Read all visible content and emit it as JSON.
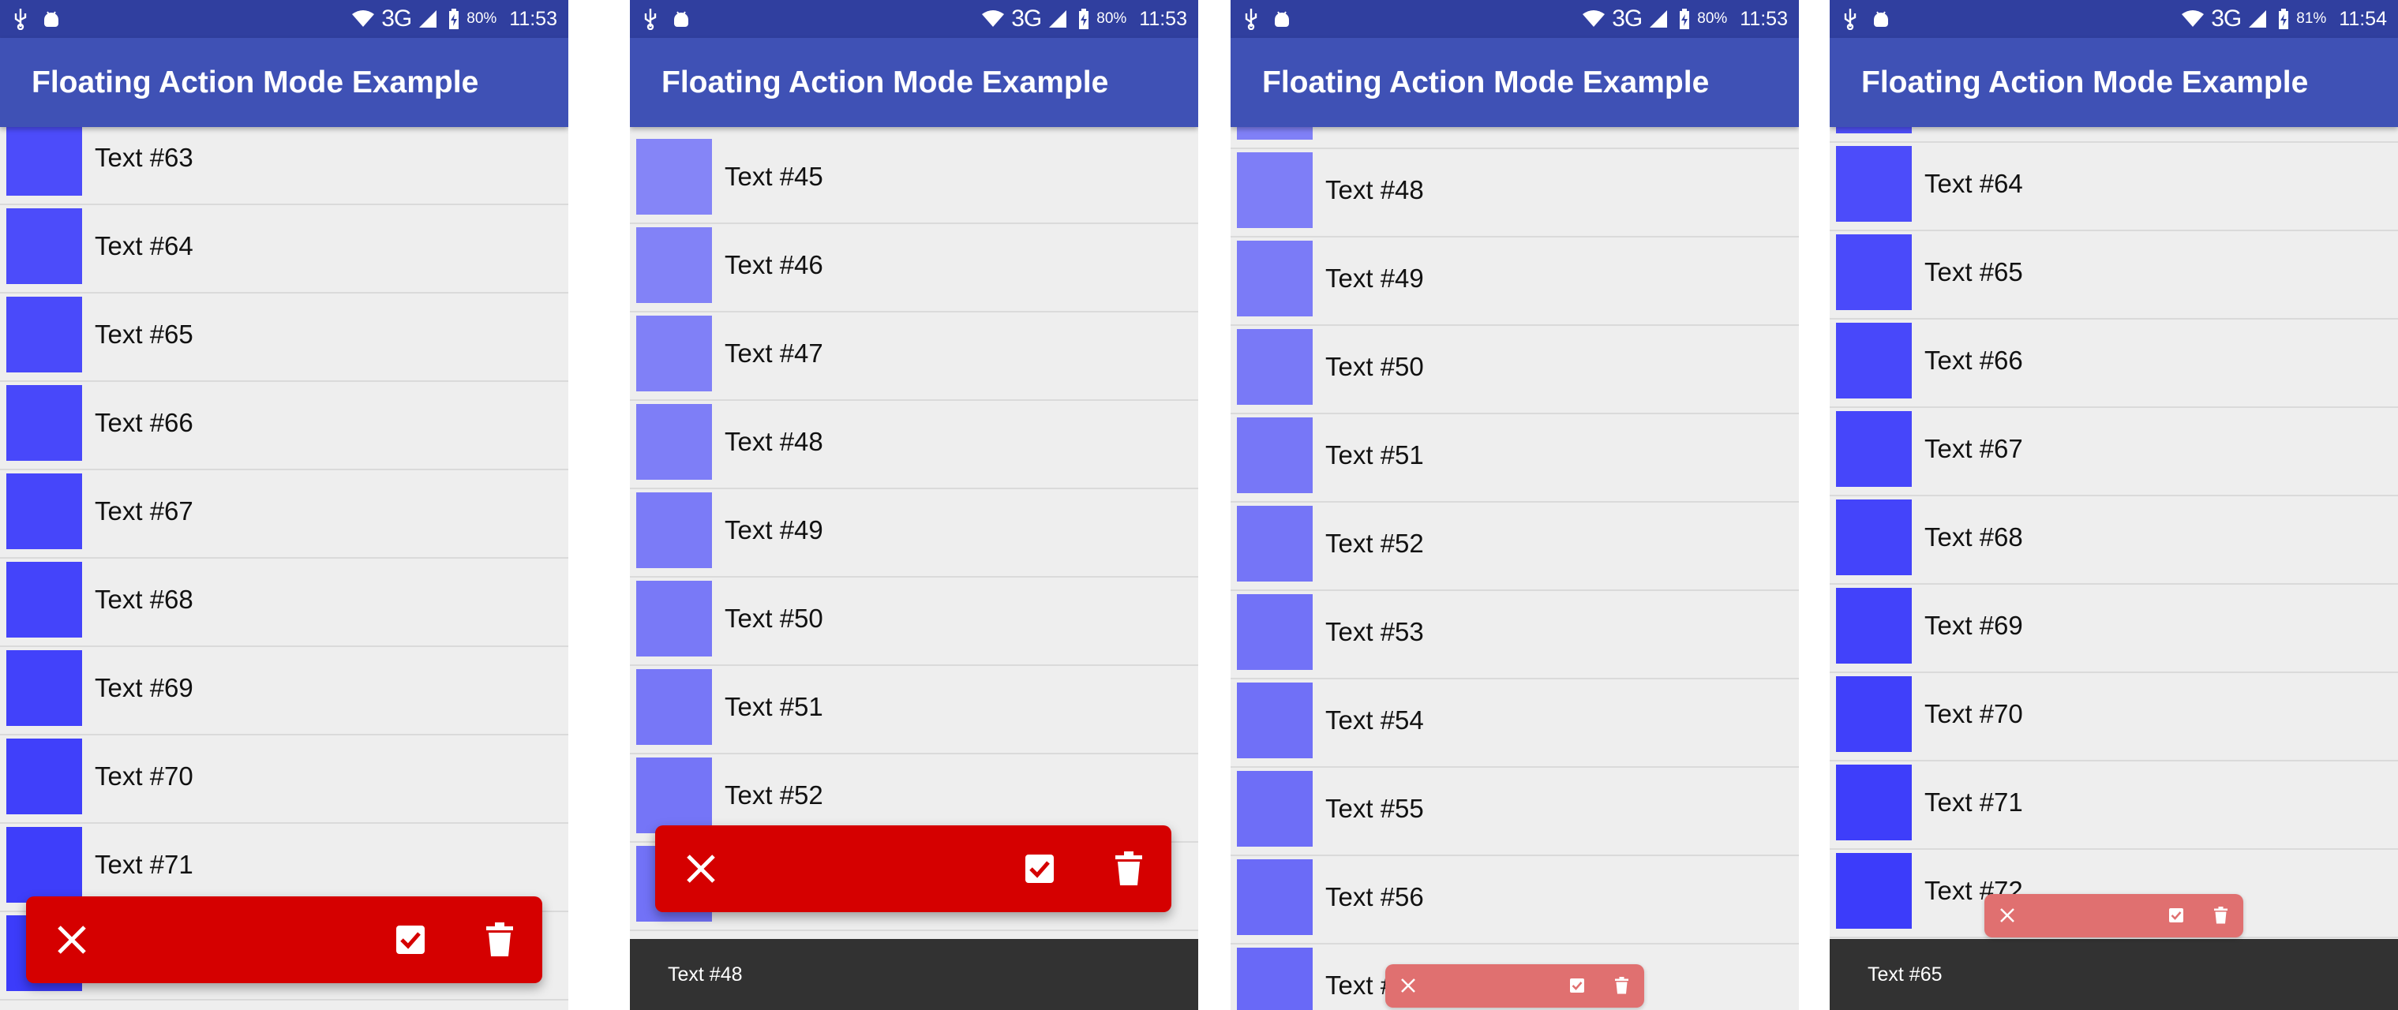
{
  "app_title": "Floating Action Mode Example",
  "phones": [
    {
      "status": {
        "network": "3G",
        "battery": "80%",
        "time": "11:53"
      },
      "rows": [
        {
          "text": "Text #63",
          "color": "#4c4cfa"
        },
        {
          "text": "Text #64",
          "color": "#4c4cfa"
        },
        {
          "text": "Text #65",
          "color": "#4a4afa"
        },
        {
          "text": "Text #66",
          "color": "#4848fa"
        },
        {
          "text": "Text #67",
          "color": "#4646fa"
        },
        {
          "text": "Text #68",
          "color": "#4444fa"
        },
        {
          "text": "Text #69",
          "color": "#4242fa"
        },
        {
          "text": "Text #70",
          "color": "#4040fa"
        },
        {
          "text": "Text #71",
          "color": "#3e3efa"
        },
        {
          "text": "",
          "color": "#3c3cfa"
        }
      ],
      "fab_bar": {
        "close": "close-icon",
        "select_all": "check-box-icon",
        "delete": "delete-icon",
        "color": "#d50000"
      }
    },
    {
      "status": {
        "network": "3G",
        "battery": "80%",
        "time": "11:53"
      },
      "rows": [
        {
          "text": "Text #45",
          "color": "#8585f7"
        },
        {
          "text": "Text #46",
          "color": "#8282f7"
        },
        {
          "text": "Text #47",
          "color": "#8080f7"
        },
        {
          "text": "Text #48",
          "color": "#7e7ef7"
        },
        {
          "text": "Text #49",
          "color": "#7b7bf7"
        },
        {
          "text": "Text #50",
          "color": "#7979f7"
        },
        {
          "text": "Text #51",
          "color": "#7777f7"
        },
        {
          "text": "Text #52",
          "color": "#7575f7"
        },
        {
          "text": "",
          "color": "#7272f7"
        }
      ],
      "fab_bar": {
        "close": "close-icon",
        "select_all": "check-box-icon",
        "delete": "delete-icon",
        "color": "#d50000"
      },
      "snackbar": "Text #48"
    },
    {
      "status": {
        "network": "3G",
        "battery": "80%",
        "time": "11:53"
      },
      "rows": [
        {
          "text": "",
          "color": "#8080f7"
        },
        {
          "text": "Text #48",
          "color": "#7e7ef7"
        },
        {
          "text": "Text #49",
          "color": "#7b7bf7"
        },
        {
          "text": "Text #50",
          "color": "#7979f7"
        },
        {
          "text": "Text #51",
          "color": "#7777f7"
        },
        {
          "text": "Text #52",
          "color": "#7575f7"
        },
        {
          "text": "Text #53",
          "color": "#7272f7"
        },
        {
          "text": "Text #54",
          "color": "#7070f7"
        },
        {
          "text": "Text #55",
          "color": "#6e6ef7"
        },
        {
          "text": "Text #56",
          "color": "#6b6bf7"
        },
        {
          "text": "Text #57",
          "color": "#6969f7"
        }
      ],
      "fab_bar": {
        "close": "close-icon",
        "select_all": "check-box-icon",
        "delete": "delete-icon",
        "color": "#e07070"
      }
    },
    {
      "status": {
        "network": "3G",
        "battery": "81%",
        "time": "11:54"
      },
      "rows": [
        {
          "text": "",
          "color": "#5050fa"
        },
        {
          "text": "Text #64",
          "color": "#4c4cfa"
        },
        {
          "text": "Text #65",
          "color": "#4a4afa"
        },
        {
          "text": "Text #66",
          "color": "#4848fa"
        },
        {
          "text": "Text #67",
          "color": "#4646fa"
        },
        {
          "text": "Text #68",
          "color": "#4444fa"
        },
        {
          "text": "Text #69",
          "color": "#4242fa"
        },
        {
          "text": "Text #70",
          "color": "#4040fa"
        },
        {
          "text": "Text #71",
          "color": "#3e3efa"
        },
        {
          "text": "Text #72",
          "color": "#3c3cfa"
        }
      ],
      "fab_bar": {
        "close": "close-icon",
        "select_all": "check-box-icon",
        "delete": "delete-icon",
        "color": "#e07070"
      },
      "snackbar": "Text #65"
    }
  ]
}
